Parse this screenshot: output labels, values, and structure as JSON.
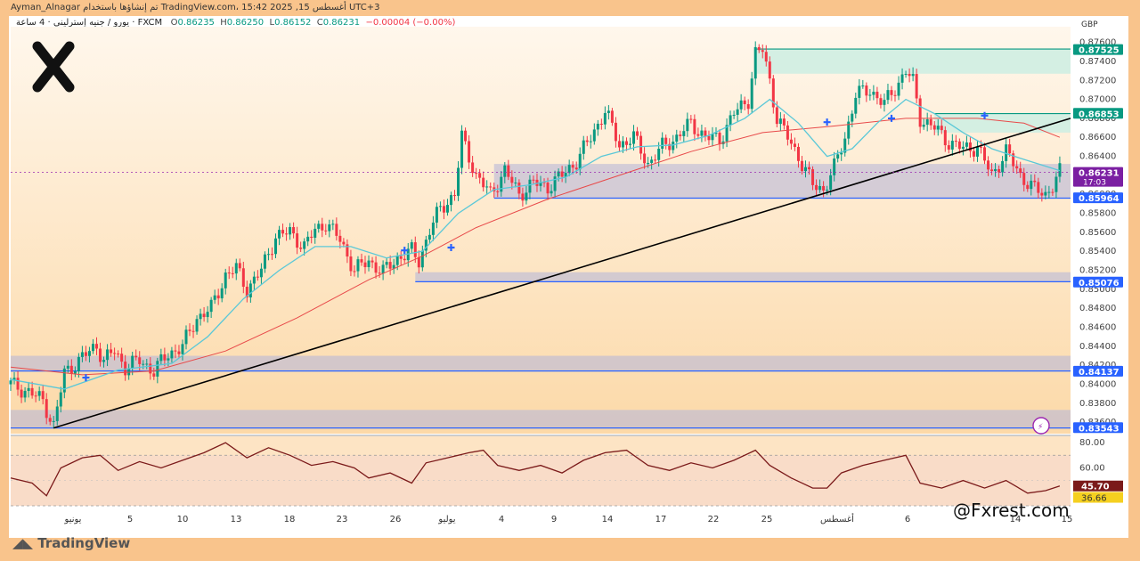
{
  "header": {
    "author": "Ayman_Alnagar",
    "published": "تم إنشاؤها باستخدام TradingView.com، 15:42 2025 ,15 أغسطس UTC+3"
  },
  "symbol_info": {
    "description": "يورو / جنيه إسترليني · 4 ساعة · FXCM",
    "open_label": "O",
    "open": "0.86235",
    "high_label": "H",
    "high": "0.86250",
    "low_label": "L",
    "low": "0.86152",
    "close_label": "C",
    "close": "0.86231",
    "change": "−0.00004 (−0.00%)"
  },
  "currency": "GBP",
  "watermark": "@Fxrest.com",
  "tv_brand": "TradingView",
  "colors": {
    "bull": "#089981",
    "bear": "#f23645",
    "ema_fast": "#5ac8d8",
    "ema_slow": "#e84a4a",
    "rsi": "#7b1a1a",
    "trendline": "#000000",
    "support": "#2962ff",
    "zone": "#b8b8d8",
    "resistance_zone": "#cfeee2",
    "price_tag": "#7b1fa2"
  },
  "price_labels": [
    {
      "value": "0.87525",
      "style": "green"
    },
    {
      "value": "0.86853",
      "style": "green"
    },
    {
      "value": "0.86231",
      "style": "purple",
      "sub": "17:03"
    },
    {
      "value": "0.85964",
      "style": "blue"
    },
    {
      "value": "0.85076",
      "style": "blue"
    },
    {
      "value": "0.84137",
      "style": "blue"
    },
    {
      "value": "0.83543",
      "style": "blue"
    }
  ],
  "rsi_labels": {
    "upper": "80.00",
    "mid": "60.00",
    "value": "45.70",
    "signal": "36.66"
  },
  "chart_data": {
    "type": "candlestick",
    "xaxis_ticks": [
      "يونيو",
      "5",
      "10",
      "13",
      "18",
      "23",
      "26",
      "يوليو",
      "4",
      "9",
      "14",
      "17",
      "22",
      "25",
      "أغسطس",
      "6",
      "14",
      "15"
    ],
    "yaxis_ticks": [
      "0.87600",
      "0.87400",
      "0.87200",
      "0.87000",
      "0.86800",
      "0.86600",
      "0.86400",
      "0.86200",
      "0.86000",
      "0.85800",
      "0.85600",
      "0.85400",
      "0.85200",
      "0.85000",
      "0.84800",
      "0.84600",
      "0.84400",
      "0.84200",
      "0.84000",
      "0.83800",
      "0.83600"
    ],
    "ylim": [
      0.8348,
      0.8769
    ],
    "close_path": [
      [
        0,
        0.84
      ],
      [
        5,
        0.8392
      ],
      [
        9,
        0.8383
      ],
      [
        12,
        0.8356
      ],
      [
        15,
        0.8412
      ],
      [
        20,
        0.8428
      ],
      [
        24,
        0.8441
      ],
      [
        26,
        0.8425
      ],
      [
        29,
        0.8435
      ],
      [
        32,
        0.8418
      ],
      [
        36,
        0.8425
      ],
      [
        40,
        0.8414
      ],
      [
        44,
        0.8432
      ],
      [
        48,
        0.844
      ],
      [
        52,
        0.847
      ],
      [
        56,
        0.848
      ],
      [
        60,
        0.8515
      ],
      [
        63,
        0.8522
      ],
      [
        66,
        0.85
      ],
      [
        70,
        0.852
      ],
      [
        74,
        0.8556
      ],
      [
        78,
        0.856
      ],
      [
        82,
        0.8545
      ],
      [
        85,
        0.8562
      ],
      [
        88,
        0.857
      ],
      [
        92,
        0.8552
      ],
      [
        96,
        0.852
      ],
      [
        100,
        0.853
      ],
      [
        104,
        0.8518
      ],
      [
        108,
        0.8533
      ],
      [
        112,
        0.854
      ],
      [
        114,
        0.853
      ],
      [
        117,
        0.8562
      ],
      [
        120,
        0.8585
      ],
      [
        124,
        0.86
      ],
      [
        126,
        0.866
      ],
      [
        130,
        0.862
      ],
      [
        134,
        0.86
      ],
      [
        138,
        0.8625
      ],
      [
        142,
        0.86
      ],
      [
        146,
        0.8612
      ],
      [
        150,
        0.8608
      ],
      [
        154,
        0.862
      ],
      [
        158,
        0.8635
      ],
      [
        162,
        0.866
      ],
      [
        166,
        0.8688
      ],
      [
        170,
        0.8652
      ],
      [
        174,
        0.866
      ],
      [
        178,
        0.8632
      ],
      [
        182,
        0.865
      ],
      [
        186,
        0.866
      ],
      [
        190,
        0.8675
      ],
      [
        194,
        0.866
      ],
      [
        198,
        0.8658
      ],
      [
        202,
        0.8685
      ],
      [
        206,
        0.87
      ],
      [
        208,
        0.8748
      ],
      [
        210,
        0.8752
      ],
      [
        212,
        0.872
      ],
      [
        214,
        0.868
      ],
      [
        217,
        0.866
      ],
      [
        220,
        0.864
      ],
      [
        224,
        0.861
      ],
      [
        227,
        0.8605
      ],
      [
        230,
        0.8628
      ],
      [
        233,
        0.866
      ],
      [
        236,
        0.8705
      ],
      [
        240,
        0.871
      ],
      [
        244,
        0.8695
      ],
      [
        247,
        0.8712
      ],
      [
        250,
        0.873
      ],
      [
        252,
        0.8718
      ],
      [
        254,
        0.868
      ],
      [
        258,
        0.867
      ],
      [
        262,
        0.8655
      ],
      [
        266,
        0.8648
      ],
      [
        270,
        0.865
      ],
      [
        274,
        0.862
      ],
      [
        278,
        0.8645
      ],
      [
        282,
        0.862
      ],
      [
        286,
        0.8605
      ],
      [
        289,
        0.86
      ],
      [
        291,
        0.861
      ],
      [
        293,
        0.8623
      ]
    ],
    "ema_fast_path": [
      [
        0,
        0.8405
      ],
      [
        15,
        0.8395
      ],
      [
        30,
        0.8415
      ],
      [
        45,
        0.8422
      ],
      [
        55,
        0.845
      ],
      [
        65,
        0.849
      ],
      [
        75,
        0.852
      ],
      [
        85,
        0.8545
      ],
      [
        95,
        0.8545
      ],
      [
        105,
        0.8533
      ],
      [
        115,
        0.854
      ],
      [
        125,
        0.858
      ],
      [
        135,
        0.8605
      ],
      [
        145,
        0.861
      ],
      [
        155,
        0.8618
      ],
      [
        165,
        0.864
      ],
      [
        175,
        0.865
      ],
      [
        185,
        0.8652
      ],
      [
        195,
        0.8662
      ],
      [
        205,
        0.868
      ],
      [
        212,
        0.87
      ],
      [
        220,
        0.8675
      ],
      [
        228,
        0.864
      ],
      [
        235,
        0.8648
      ],
      [
        242,
        0.8675
      ],
      [
        250,
        0.87
      ],
      [
        258,
        0.8685
      ],
      [
        266,
        0.8665
      ],
      [
        274,
        0.8648
      ],
      [
        282,
        0.8638
      ],
      [
        293,
        0.8625
      ]
    ],
    "ema_slow_path": [
      [
        0,
        0.8418
      ],
      [
        20,
        0.841
      ],
      [
        40,
        0.8414
      ],
      [
        60,
        0.8435
      ],
      [
        80,
        0.847
      ],
      [
        100,
        0.851
      ],
      [
        115,
        0.8535
      ],
      [
        130,
        0.8565
      ],
      [
        150,
        0.8595
      ],
      [
        170,
        0.862
      ],
      [
        190,
        0.8645
      ],
      [
        210,
        0.8665
      ],
      [
        230,
        0.8672
      ],
      [
        250,
        0.868
      ],
      [
        270,
        0.868
      ],
      [
        283,
        0.8675
      ],
      [
        293,
        0.866
      ]
    ],
    "trendline": [
      [
        12,
        0.8354
      ],
      [
        296,
        0.868
      ]
    ],
    "zones": [
      {
        "label": "resistance",
        "from_bar": 208,
        "to_bar": 296,
        "low": 0.8727,
        "high": 0.8753
      },
      {
        "label": "resistance",
        "from_bar": 258,
        "to_bar": 296,
        "low": 0.8665,
        "high": 0.8685
      },
      {
        "label": "support",
        "from_bar": 135,
        "to_bar": 296,
        "low": 0.8596,
        "high": 0.8632
      },
      {
        "label": "support",
        "from_bar": 113,
        "to_bar": 296,
        "low": 0.8508,
        "high": 0.8518
      },
      {
        "label": "support",
        "from_bar": 0,
        "to_bar": 296,
        "low": 0.8414,
        "high": 0.843
      },
      {
        "label": "support",
        "from_bar": 0,
        "to_bar": 296,
        "low": 0.8354,
        "high": 0.8373
      }
    ],
    "markers": [
      [
        21,
        0.8407
      ],
      [
        110,
        0.8541
      ],
      [
        123,
        0.8544
      ],
      [
        228,
        0.8676
      ],
      [
        246,
        0.868
      ],
      [
        272,
        0.8683
      ]
    ],
    "rsi_path": [
      [
        0,
        52
      ],
      [
        6,
        48
      ],
      [
        10,
        38
      ],
      [
        14,
        60
      ],
      [
        20,
        68
      ],
      [
        25,
        70
      ],
      [
        30,
        58
      ],
      [
        36,
        65
      ],
      [
        42,
        60
      ],
      [
        48,
        66
      ],
      [
        54,
        72
      ],
      [
        60,
        80
      ],
      [
        66,
        68
      ],
      [
        72,
        76
      ],
      [
        78,
        70
      ],
      [
        84,
        62
      ],
      [
        90,
        65
      ],
      [
        96,
        60
      ],
      [
        100,
        52
      ],
      [
        106,
        56
      ],
      [
        112,
        48
      ],
      [
        116,
        64
      ],
      [
        122,
        68
      ],
      [
        128,
        72
      ],
      [
        132,
        74
      ],
      [
        136,
        62
      ],
      [
        142,
        58
      ],
      [
        148,
        62
      ],
      [
        154,
        56
      ],
      [
        160,
        66
      ],
      [
        166,
        72
      ],
      [
        172,
        74
      ],
      [
        178,
        62
      ],
      [
        184,
        58
      ],
      [
        190,
        64
      ],
      [
        196,
        60
      ],
      [
        202,
        66
      ],
      [
        208,
        74
      ],
      [
        212,
        62
      ],
      [
        218,
        52
      ],
      [
        224,
        44
      ],
      [
        228,
        44
      ],
      [
        232,
        56
      ],
      [
        238,
        62
      ],
      [
        244,
        66
      ],
      [
        250,
        70
      ],
      [
        254,
        48
      ],
      [
        260,
        44
      ],
      [
        266,
        50
      ],
      [
        272,
        44
      ],
      [
        278,
        50
      ],
      [
        284,
        40
      ],
      [
        289,
        42
      ],
      [
        293,
        45.7
      ]
    ],
    "rsi_ylim": [
      30,
      85
    ]
  }
}
